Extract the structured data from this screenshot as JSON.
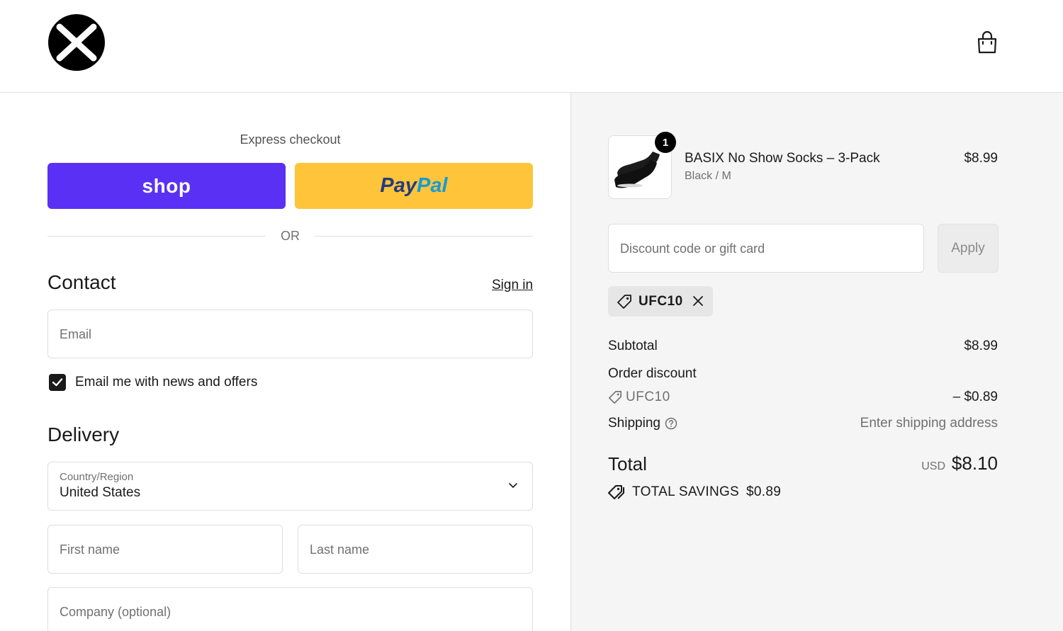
{
  "header": {
    "logo_icon": "x-circle-logo",
    "cart_icon": "shopping-bag-icon"
  },
  "express": {
    "title": "Express checkout",
    "shop_label": "shop",
    "paypal_label_1": "Pay",
    "paypal_label_2": "Pal",
    "shop_color": "#5a31f4",
    "paypal_color": "#ffc439"
  },
  "divider": {
    "label": "OR"
  },
  "contact": {
    "title": "Contact",
    "sign_in": "Sign in",
    "email_placeholder": "Email",
    "newsletter_label": "Email me with news and offers",
    "newsletter_checked": true
  },
  "delivery": {
    "title": "Delivery",
    "country_label": "Country/Region",
    "country_value": "United States",
    "first_name_placeholder": "First name",
    "last_name_placeholder": "Last name",
    "company_placeholder": "Company (optional)"
  },
  "summary": {
    "item": {
      "quantity": "1",
      "name": "BASIX No Show Socks – 3-Pack",
      "variant": "Black / M",
      "price": "$8.99",
      "image_icon": "socks-image"
    },
    "discount_placeholder": "Discount code or gift card",
    "apply_label": "Apply",
    "applied_code": "UFC10",
    "subtotal_label": "Subtotal",
    "subtotal_value": "$8.99",
    "order_discount_label": "Order discount",
    "discount_code": "UFC10",
    "discount_value": "– $0.89",
    "shipping_label": "Shipping",
    "shipping_value": "Enter shipping address",
    "total_label": "Total",
    "total_currency": "USD",
    "total_value": "$8.10",
    "savings_label": "TOTAL SAVINGS",
    "savings_value": "$0.89"
  }
}
